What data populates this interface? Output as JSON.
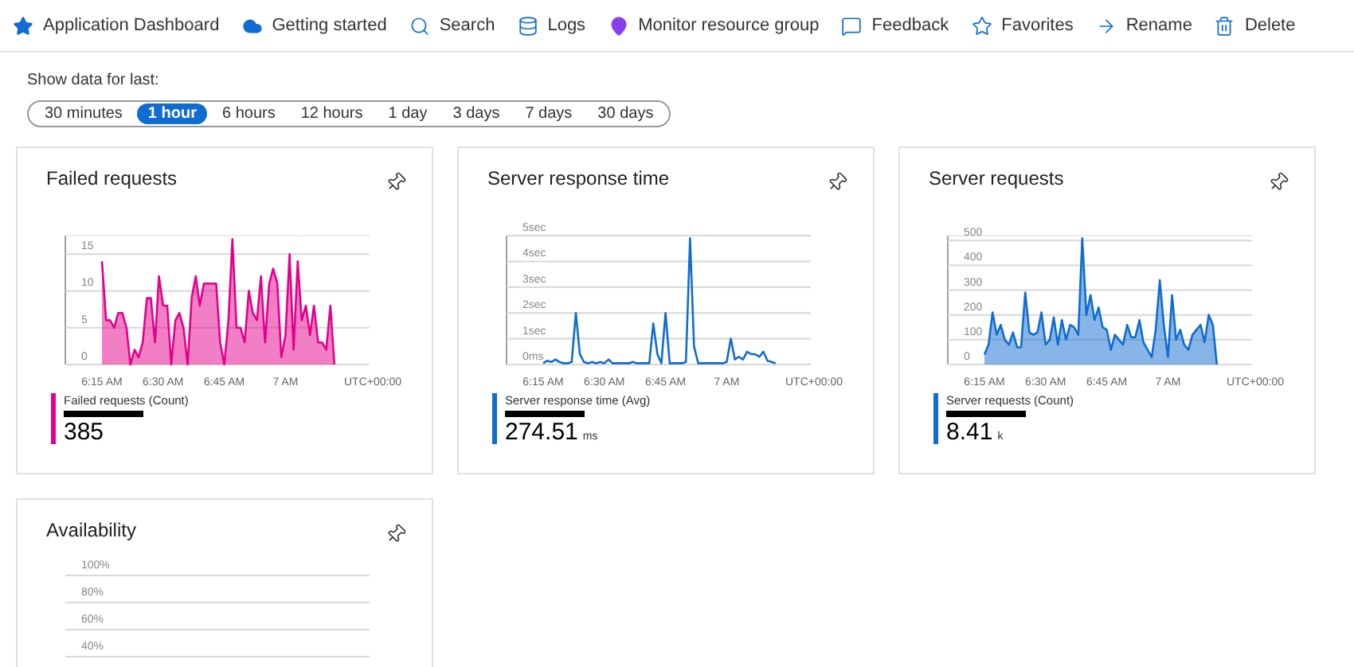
{
  "toolbar": [
    {
      "kind": "dashboard",
      "label": "Application Dashboard"
    },
    {
      "kind": "start",
      "label": "Getting started"
    },
    {
      "kind": "search",
      "label": "Search"
    },
    {
      "kind": "logs",
      "label": "Logs"
    },
    {
      "kind": "monitor",
      "label": "Monitor resource group"
    },
    {
      "kind": "feedback",
      "label": "Feedback"
    },
    {
      "kind": "favorites",
      "label": "Favorites"
    },
    {
      "kind": "rename",
      "label": "Rename"
    },
    {
      "kind": "delete",
      "label": "Delete"
    }
  ],
  "time_range": {
    "label": "Show data for last:",
    "options": [
      {
        "label": "30 minutes",
        "selected": false
      },
      {
        "label": "1 hour",
        "selected": true
      },
      {
        "label": "6 hours",
        "selected": false
      },
      {
        "label": "12 hours",
        "selected": false
      },
      {
        "label": "1 day",
        "selected": false
      },
      {
        "label": "3 days",
        "selected": false
      },
      {
        "label": "7 days",
        "selected": false
      },
      {
        "label": "30 days",
        "selected": false
      }
    ]
  },
  "tiles": [
    {
      "title": "Failed requests",
      "value": "385",
      "color": "#e3008c",
      "timezone": "UTC+00:00",
      "chart_data": {
        "type": "area",
        "categories": [
          "6:15 AM",
          null,
          null,
          null,
          null,
          null,
          null,
          null,
          null,
          null,
          null,
          null,
          null,
          null,
          null,
          "6:30 AM",
          null,
          null,
          null,
          null,
          null,
          null,
          null,
          null,
          null,
          null,
          null,
          null,
          null,
          null,
          "6:45 AM",
          null,
          null,
          null,
          null,
          null,
          null,
          null,
          null,
          null,
          null,
          null,
          null,
          null,
          null,
          "7 AM",
          null,
          null,
          null,
          null,
          null,
          null,
          null,
          null,
          null,
          null,
          null,
          null
        ],
        "series": [
          {
            "name": "Failed requests (Count)",
            "color": "#e3008c",
            "values": [
              14,
              6,
              6,
              5,
              7,
              7,
              5,
              0,
              2,
              1,
              3,
              9,
              9,
              3,
              12,
              8,
              8,
              0,
              6,
              7,
              5,
              0,
              9,
              12,
              8,
              11,
              11,
              11,
              11,
              3,
              0,
              6,
              17,
              5,
              5,
              3,
              10,
              7,
              6,
              12,
              3,
              11,
              13,
              11,
              1,
              4,
              15,
              2,
              14,
              6,
              8,
              4,
              8,
              3,
              3,
              2,
              8,
              0
            ]
          }
        ],
        "grid": true,
        "ylim": [
          0,
          17.5
        ],
        "yticks": [
          {
            "value": 0,
            "label": "0"
          },
          {
            "value": 5,
            "label": "5"
          },
          {
            "value": 10,
            "label": "10"
          },
          {
            "value": 15,
            "label": "15"
          }
        ]
      }
    },
    {
      "title": "Server response time",
      "value": "274.51",
      "unit": "ms",
      "color": "#0f6cd1",
      "timezone": "UTC+00:00",
      "chart_data": {
        "type": "line",
        "categories": [
          "6:15 AM",
          null,
          null,
          null,
          null,
          null,
          null,
          null,
          null,
          null,
          null,
          null,
          null,
          null,
          null,
          "6:30 AM",
          null,
          null,
          null,
          null,
          null,
          null,
          null,
          null,
          null,
          null,
          null,
          null,
          null,
          null,
          "6:45 AM",
          null,
          null,
          null,
          null,
          null,
          null,
          null,
          null,
          null,
          null,
          null,
          null,
          null,
          null,
          "7 AM",
          null,
          null,
          null,
          null,
          null,
          null,
          null,
          null,
          null,
          null,
          null,
          null
        ],
        "series": [
          {
            "name": "Server response time (Avg)",
            "color": "#0f6cd1",
            "values": [
              0.05,
              0.15,
              0.1,
              0.2,
              0.1,
              0.05,
              0.05,
              0.1,
              2,
              0.4,
              0.1,
              0.05,
              0.1,
              0.05,
              0.1,
              0.05,
              0.2,
              0.05,
              0.05,
              0.05,
              0.05,
              0.05,
              0.1,
              0.05,
              0.05,
              0.05,
              0.05,
              1.6,
              0.4,
              0.05,
              2,
              0.05,
              0.05,
              0.05,
              0.05,
              0.1,
              4.9,
              0.7,
              0.05,
              0.05,
              0.05,
              0.05,
              0.05,
              0.05,
              0.05,
              0.1,
              1,
              0.2,
              0.3,
              0.2,
              0.5,
              0.4,
              0.4,
              0.3,
              0.5,
              0.15,
              0.1,
              0.05
            ]
          }
        ],
        "grid": true,
        "ylim": [
          0,
          5
        ],
        "yticks": [
          {
            "value": 0,
            "label": "0ms"
          },
          {
            "value": 1,
            "label": "1sec"
          },
          {
            "value": 2,
            "label": "2sec"
          },
          {
            "value": 3,
            "label": "3sec"
          },
          {
            "value": 4,
            "label": "4sec"
          },
          {
            "value": 5,
            "label": "5sec"
          }
        ]
      }
    },
    {
      "title": "Server requests",
      "value": "8.41",
      "unit": "k",
      "color": "#0f6cd1",
      "timezone": "UTC+00:00",
      "chart_data": {
        "type": "area",
        "categories": [
          "6:15 AM",
          null,
          null,
          null,
          null,
          null,
          null,
          null,
          null,
          null,
          null,
          null,
          null,
          null,
          null,
          "6:30 AM",
          null,
          null,
          null,
          null,
          null,
          null,
          null,
          null,
          null,
          null,
          null,
          null,
          null,
          null,
          "6:45 AM",
          null,
          null,
          null,
          null,
          null,
          null,
          null,
          null,
          null,
          null,
          null,
          null,
          null,
          null,
          "7 AM",
          null,
          null,
          null,
          null,
          null,
          null,
          null,
          null,
          null,
          null,
          null,
          null
        ],
        "series": [
          {
            "name": "Server requests (Count)",
            "color": "#0f6cd1",
            "values": [
              40,
              80,
              210,
              120,
              160,
              100,
              80,
              130,
              70,
              70,
              290,
              130,
              120,
              130,
              210,
              80,
              100,
              190,
              80,
              180,
              100,
              160,
              150,
              120,
              510,
              200,
              280,
              180,
              230,
              150,
              140,
              60,
              120,
              100,
              80,
              160,
              110,
              110,
              180,
              90,
              60,
              30,
              140,
              340,
              160,
              30,
              280,
              100,
              140,
              80,
              60,
              120,
              140,
              160,
              90,
              200,
              160,
              0
            ]
          }
        ],
        "grid": true,
        "ylim": [
          0,
          520
        ],
        "yticks": [
          {
            "value": 0,
            "label": "0"
          },
          {
            "value": 100,
            "label": "100"
          },
          {
            "value": 200,
            "label": "200"
          },
          {
            "value": 300,
            "label": "300"
          },
          {
            "value": 400,
            "label": "400"
          },
          {
            "value": 500,
            "label": "500"
          }
        ]
      }
    },
    {
      "title": "Availability",
      "axis_labels": [
        "100%",
        "80%",
        "60%",
        "40%"
      ]
    }
  ]
}
